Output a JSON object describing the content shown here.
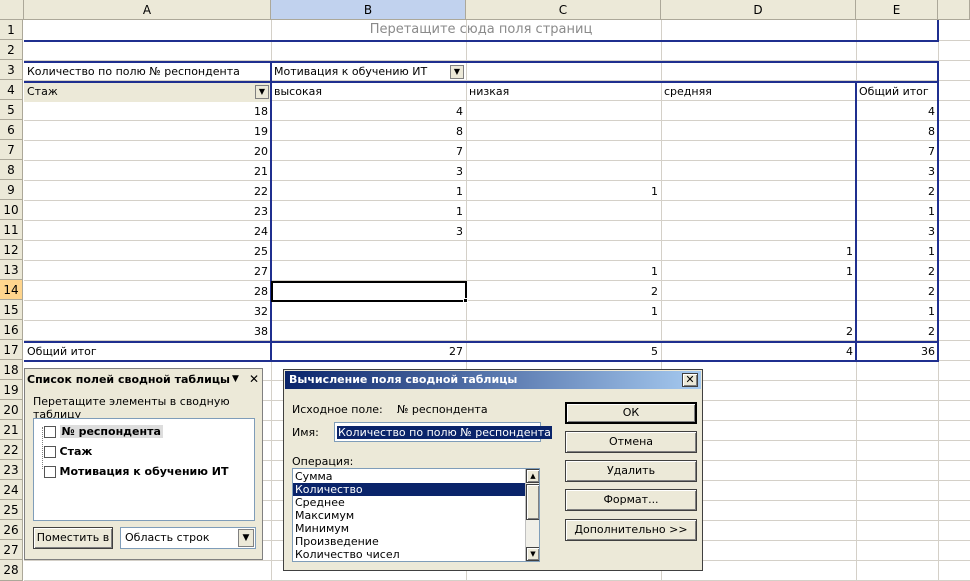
{
  "columns": [
    "A",
    "B",
    "C",
    "D",
    "E"
  ],
  "rows": [
    "1",
    "2",
    "3",
    "4",
    "5",
    "6",
    "7",
    "8",
    "9",
    "10",
    "11",
    "12",
    "13",
    "14",
    "15",
    "16",
    "17",
    "18",
    "19",
    "20",
    "21",
    "22",
    "23",
    "24",
    "25",
    "26",
    "27",
    "28"
  ],
  "pivot": {
    "page_drop_hint": "Перетащите сюда поля страниц",
    "data_field": "Количество по полю № респондента",
    "column_field": "Мотивация к обучению ИТ",
    "row_field": "Стаж",
    "col_items": [
      "высокая",
      "низкая",
      "средняя",
      "Общий итог"
    ],
    "body": [
      [
        "18",
        "4",
        "",
        "",
        "4"
      ],
      [
        "19",
        "8",
        "",
        "",
        "8"
      ],
      [
        "20",
        "7",
        "",
        "",
        "7"
      ],
      [
        "21",
        "3",
        "",
        "",
        "3"
      ],
      [
        "22",
        "1",
        "1",
        "",
        "2"
      ],
      [
        "23",
        "1",
        "",
        "",
        "1"
      ],
      [
        "24",
        "3",
        "",
        "",
        "3"
      ],
      [
        "25",
        "",
        "",
        "1",
        "1"
      ],
      [
        "27",
        "",
        "1",
        "1",
        "2"
      ],
      [
        "28",
        "",
        "2",
        "",
        "2"
      ],
      [
        "32",
        "",
        "1",
        "",
        "1"
      ],
      [
        "38",
        "",
        "",
        "2",
        "2"
      ]
    ],
    "grand_total_label": "Общий итог",
    "grand_total": [
      "27",
      "5",
      "4",
      "36"
    ]
  },
  "field_list": {
    "title": "Список полей сводной таблицы",
    "hint": "Перетащите элементы в сводную таблицу",
    "fields": [
      "№ респондента",
      "Стаж",
      "Мотивация к обучению ИТ"
    ],
    "place_button": "Поместить в",
    "area_value": "Область строк"
  },
  "calc_dialog": {
    "title": "Вычисление поля сводной таблицы",
    "source_label": "Исходное поле:",
    "source_value": "№ респондента",
    "name_label": "Имя:",
    "name_value": "Количество по полю № респондента",
    "operation_label": "Операция:",
    "operations": [
      "Сумма",
      "Количество",
      "Среднее",
      "Максимум",
      "Минимум",
      "Произведение",
      "Количество чисел"
    ],
    "selected_operation": "Количество",
    "ok": "ОК",
    "cancel": "Отмена",
    "delete": "Удалить",
    "format": "Формат...",
    "advanced": "Дополнительно >>"
  },
  "colors": {
    "pivot_border": "#1f2f8f",
    "title_dark": "#0a246a",
    "selection": "#0a246a"
  }
}
